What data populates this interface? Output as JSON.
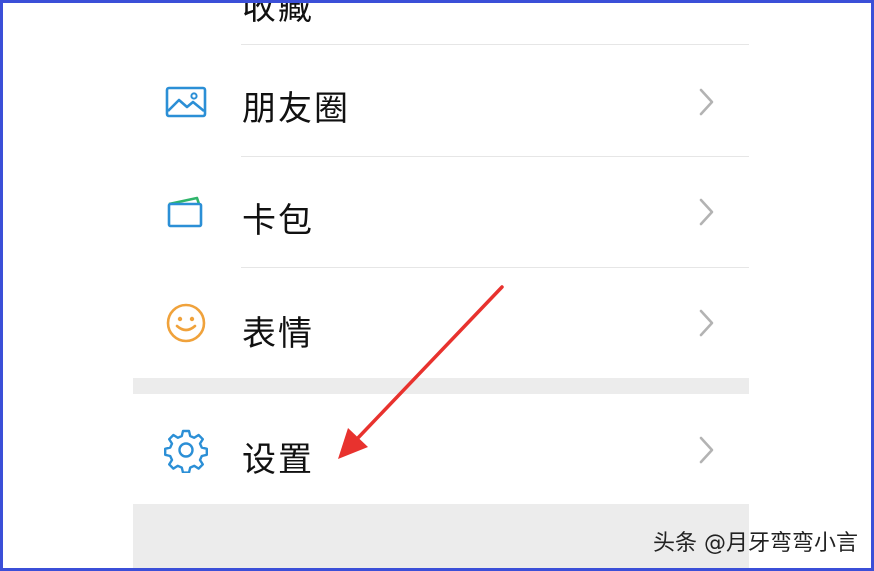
{
  "menu": {
    "items": [
      {
        "id": "favorites",
        "label": "收藏",
        "icon": "favorites-cube-icon"
      },
      {
        "id": "moments",
        "label": "朋友圈",
        "icon": "image-icon"
      },
      {
        "id": "cards",
        "label": "卡包",
        "icon": "wallet-card-icon"
      },
      {
        "id": "stickers",
        "label": "表情",
        "icon": "smiley-face-icon"
      },
      {
        "id": "settings",
        "label": "设置",
        "icon": "gear-icon"
      }
    ]
  },
  "annotation": {
    "arrow_color": "#e8322e"
  },
  "watermark": "头条 @月牙弯弯小言",
  "colors": {
    "frame": "#3b4fd8",
    "icon_blue": "#2b8fd6",
    "icon_orange": "#f0a23b",
    "divider": "#e6e6e6",
    "gap": "#ececec"
  }
}
